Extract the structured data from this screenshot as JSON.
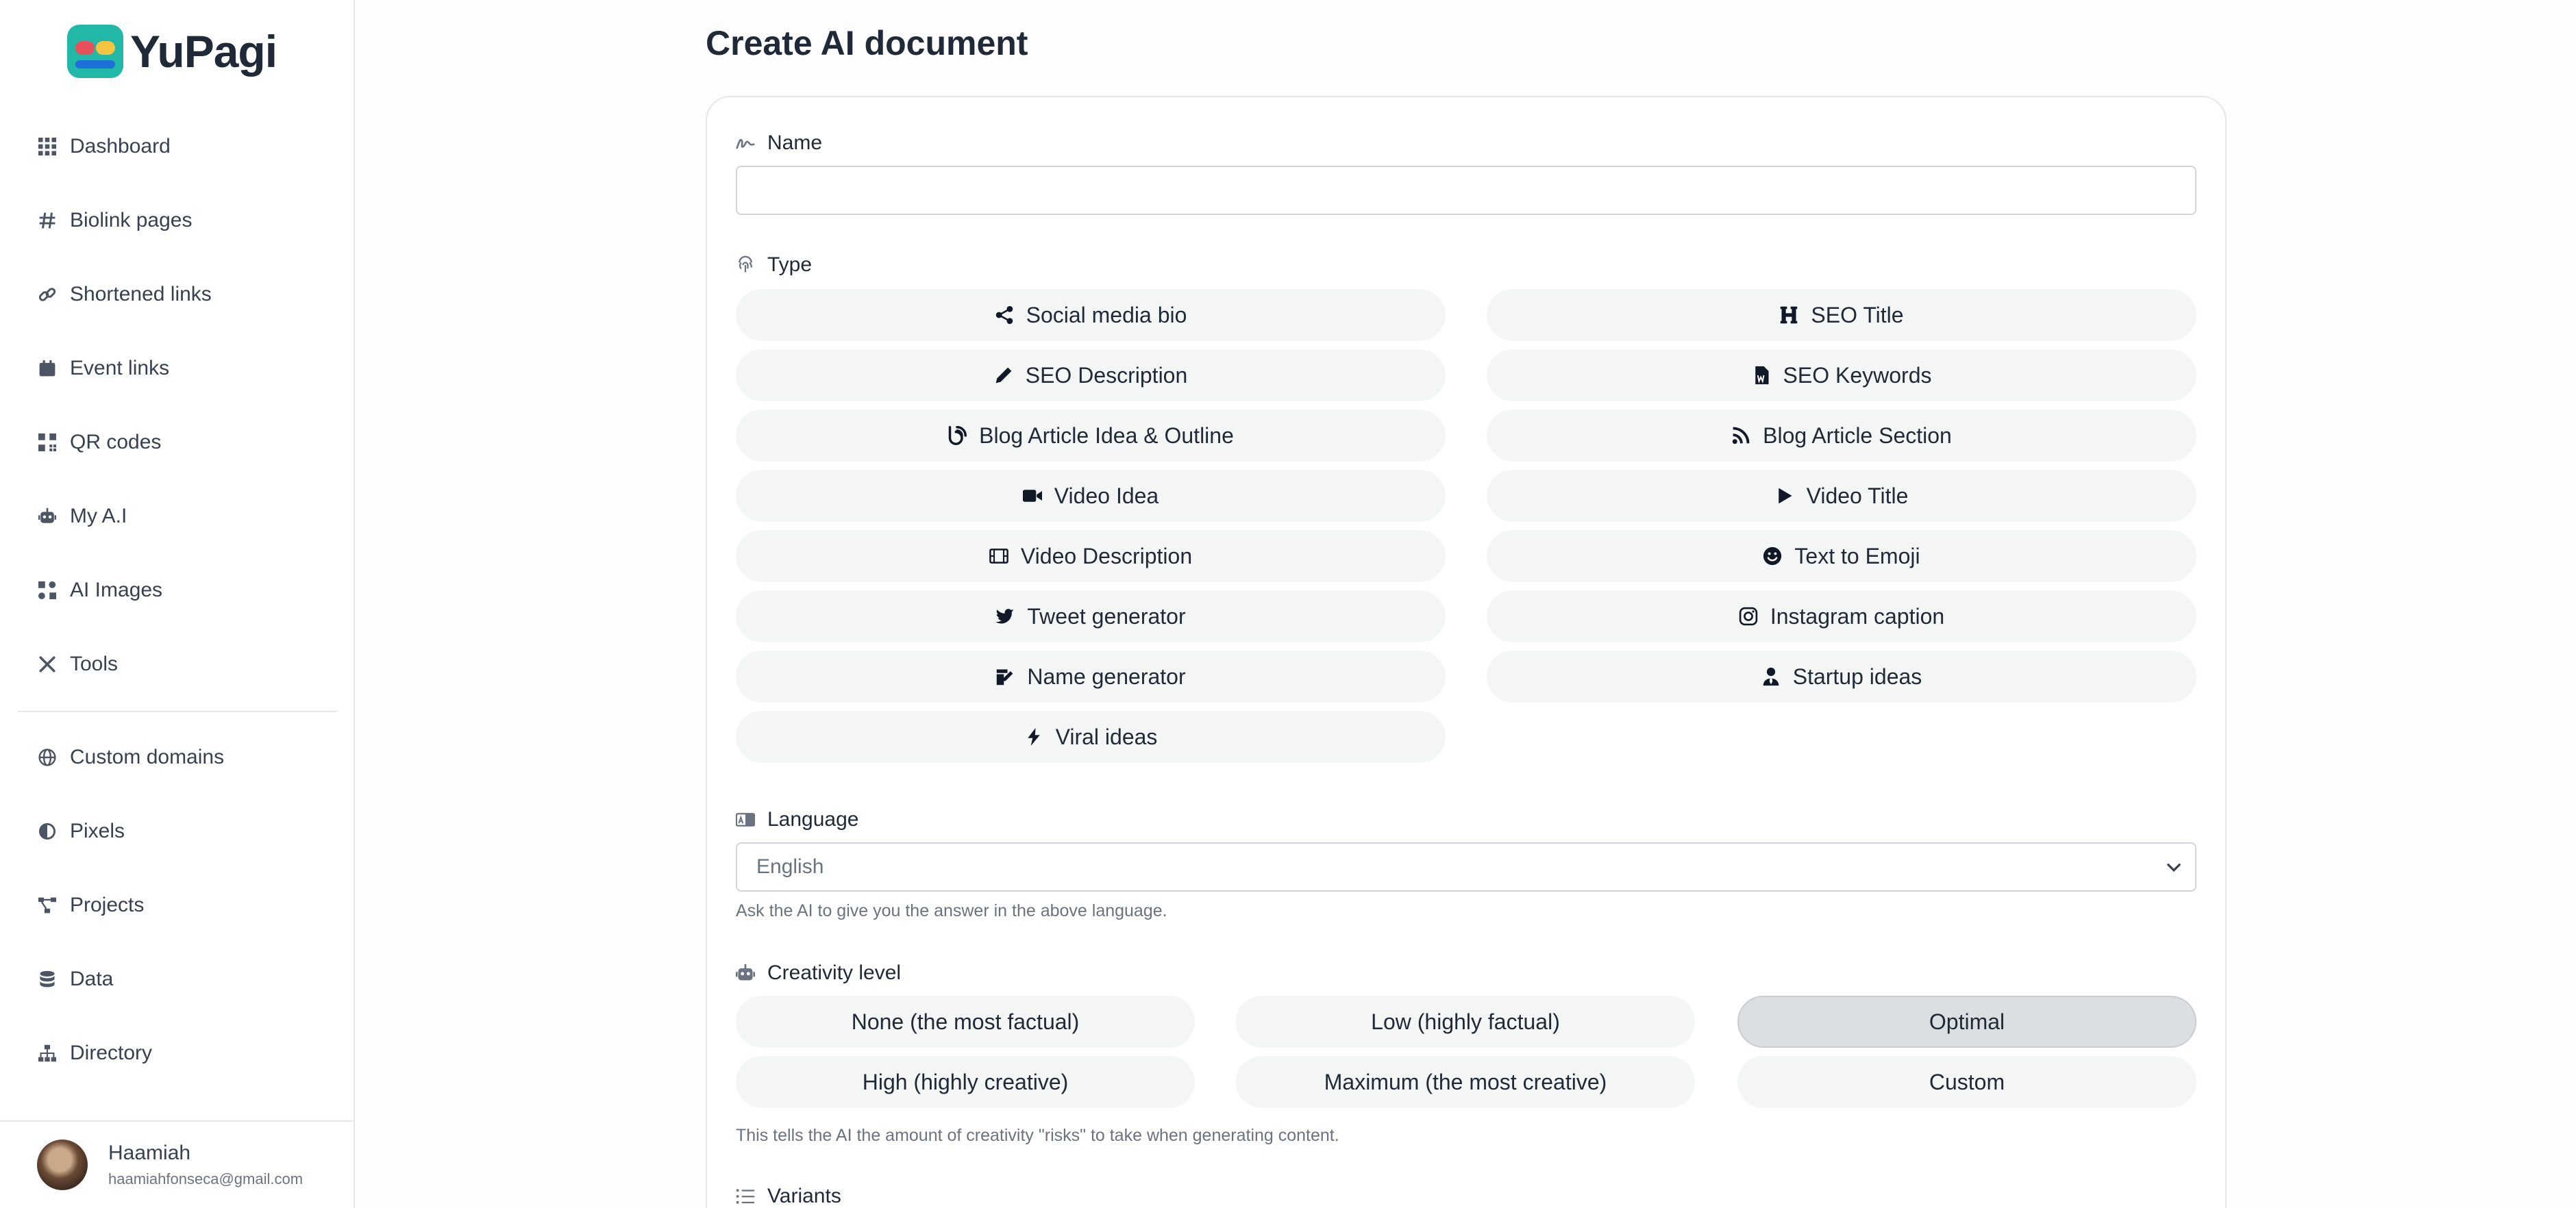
{
  "brand": {
    "name": "YuPagi"
  },
  "sidebar": {
    "items": [
      {
        "label": "Dashboard",
        "icon": "grid-icon"
      },
      {
        "label": "Biolink pages",
        "icon": "hash-icon"
      },
      {
        "label": "Shortened links",
        "icon": "link-icon"
      },
      {
        "label": "Event links",
        "icon": "calendar-icon"
      },
      {
        "label": "QR codes",
        "icon": "qrcode-icon"
      },
      {
        "label": "My A.I",
        "icon": "robot-icon"
      },
      {
        "label": "AI Images",
        "icon": "ai-images-icon"
      },
      {
        "label": "Tools",
        "icon": "tools-icon"
      },
      {
        "label": "Custom domains",
        "icon": "globe-icon"
      },
      {
        "label": "Pixels",
        "icon": "adjust-icon"
      },
      {
        "label": "Projects",
        "icon": "project-diagram-icon"
      },
      {
        "label": "Data",
        "icon": "database-icon"
      },
      {
        "label": "Directory",
        "icon": "sitemap-icon"
      }
    ]
  },
  "user": {
    "name": "Haamiah",
    "email": "haamiahfonseca@gmail.com"
  },
  "page": {
    "title": "Create AI document"
  },
  "form": {
    "name_label": "Name",
    "name_value": "",
    "type_label": "Type",
    "types": [
      {
        "label": "Social media bio",
        "icon": "share-icon"
      },
      {
        "label": "SEO Title",
        "icon": "heading-icon"
      },
      {
        "label": "SEO Description",
        "icon": "pencil-icon"
      },
      {
        "label": "SEO Keywords",
        "icon": "file-word-icon"
      },
      {
        "label": "Blog Article Idea & Outline",
        "icon": "blog-icon"
      },
      {
        "label": "Blog Article Section",
        "icon": "rss-icon"
      },
      {
        "label": "Video Idea",
        "icon": "video-camera-icon"
      },
      {
        "label": "Video Title",
        "icon": "play-icon"
      },
      {
        "label": "Video Description",
        "icon": "film-icon"
      },
      {
        "label": "Text to Emoji",
        "icon": "smile-icon"
      },
      {
        "label": "Tweet generator",
        "icon": "twitter-icon"
      },
      {
        "label": "Instagram caption",
        "icon": "instagram-icon"
      },
      {
        "label": "Name generator",
        "icon": "signature-icon"
      },
      {
        "label": "Startup ideas",
        "icon": "user-tie-icon"
      },
      {
        "label": "Viral ideas",
        "icon": "bolt-icon"
      }
    ],
    "language_label": "Language",
    "language_value": "English",
    "language_help": "Ask the AI to give you the answer in the above language.",
    "creativity_label": "Creativity level",
    "creativity_options": [
      {
        "label": "None (the most factual)"
      },
      {
        "label": "Low (highly factual)"
      },
      {
        "label": "Optimal"
      },
      {
        "label": "High (highly creative)"
      },
      {
        "label": "Maximum (the most creative)"
      },
      {
        "label": "Custom"
      }
    ],
    "creativity_selected": "Optimal",
    "creativity_help": "This tells the AI the amount of creativity \"risks\" to take when generating content.",
    "variants_label": "Variants"
  },
  "colors": {
    "accent_selected": "#dcdfe1",
    "button_bg": "#f4f5f5",
    "border": "#e5e7eb"
  }
}
